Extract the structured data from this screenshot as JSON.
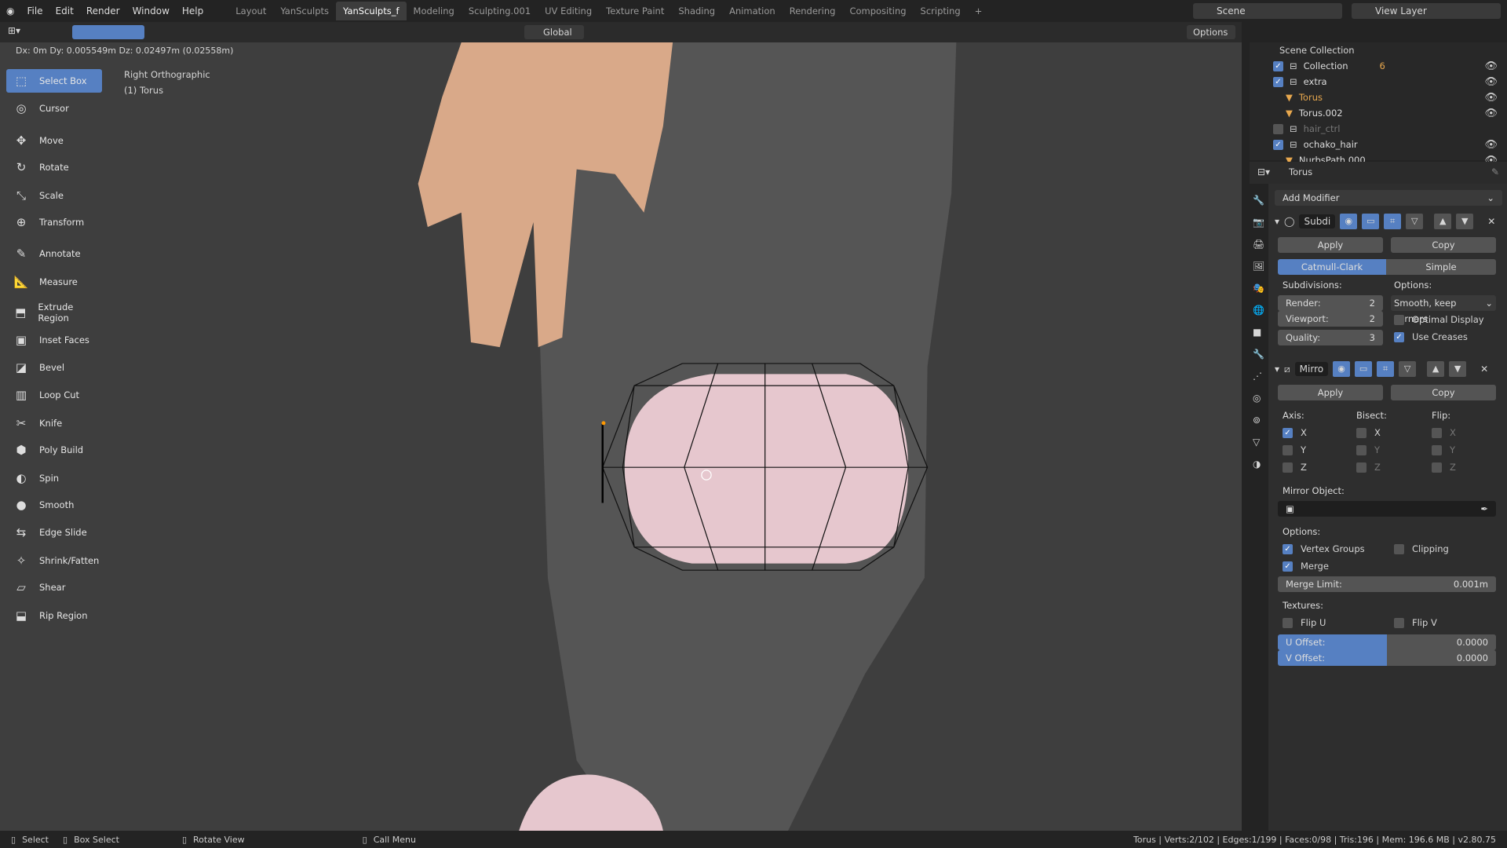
{
  "menu": [
    "File",
    "Edit",
    "Render",
    "Window",
    "Help"
  ],
  "workspaces": [
    "Layout",
    "YanSculpts",
    "YanSculpts_f",
    "Modeling",
    "Sculpting.001",
    "UV Editing",
    "Texture Paint",
    "Shading",
    "Animation",
    "Rendering",
    "Compositing",
    "Scripting",
    "+"
  ],
  "active_workspace": "YanSculpts_f",
  "scene": "Scene",
  "view_layer": "View Layer",
  "header": {
    "orientation": "Global",
    "options": "Options"
  },
  "transform_readout": "Dx: 0m  Dy: 0.005549m  Dz: 0.02497m (0.02558m)",
  "viewport": {
    "view_name": "Right Orthographic",
    "object_name": "(1) Torus"
  },
  "tools": [
    {
      "label": "Select Box",
      "icon": "select-box-icon",
      "active": true
    },
    {
      "label": "Cursor",
      "icon": "cursor-icon"
    },
    {
      "label": "Move",
      "icon": "move-icon"
    },
    {
      "label": "Rotate",
      "icon": "rotate-icon"
    },
    {
      "label": "Scale",
      "icon": "scale-icon"
    },
    {
      "label": "Transform",
      "icon": "transform-icon"
    },
    {
      "label": "Annotate",
      "icon": "annotate-icon"
    },
    {
      "label": "Measure",
      "icon": "measure-icon"
    },
    {
      "label": "Extrude Region",
      "icon": "extrude-icon"
    },
    {
      "label": "Inset Faces",
      "icon": "inset-icon"
    },
    {
      "label": "Bevel",
      "icon": "bevel-icon"
    },
    {
      "label": "Loop Cut",
      "icon": "loop-cut-icon"
    },
    {
      "label": "Knife",
      "icon": "knife-icon"
    },
    {
      "label": "Poly Build",
      "icon": "poly-build-icon"
    },
    {
      "label": "Spin",
      "icon": "spin-icon"
    },
    {
      "label": "Smooth",
      "icon": "smooth-icon"
    },
    {
      "label": "Edge Slide",
      "icon": "edge-slide-icon"
    },
    {
      "label": "Shrink/Fatten",
      "icon": "shrink-fatten-icon"
    },
    {
      "label": "Shear",
      "icon": "shear-icon"
    },
    {
      "label": "Rip Region",
      "icon": "rip-region-icon"
    }
  ],
  "outliner": {
    "root": "Scene Collection",
    "items": [
      {
        "label": "Collection",
        "checked": true,
        "badge": "6"
      },
      {
        "label": "extra",
        "checked": true
      },
      {
        "label": "Torus",
        "selected": true
      },
      {
        "label": "Torus.002"
      },
      {
        "label": "hair_ctrl",
        "checked": false
      },
      {
        "label": "ochako_hair",
        "checked": true
      },
      {
        "label": "NurbsPath.000"
      }
    ]
  },
  "properties": {
    "object": "Torus",
    "add_modifier": "Add Modifier",
    "subsurf": {
      "name": "Subdi",
      "apply": "Apply",
      "copy": "Copy",
      "catmull": "Catmull-Clark",
      "simple": "Simple",
      "subdivisions": "Subdivisions:",
      "options": "Options:",
      "render_label": "Render:",
      "render": "2",
      "viewport_label": "Viewport:",
      "viewport": "2",
      "quality_label": "Quality:",
      "quality": "3",
      "uv_smooth": "Smooth, keep corners",
      "optimal_display": "Optimal Display",
      "use_creases": "Use Creases"
    },
    "mirror": {
      "name": "Mirro",
      "apply": "Apply",
      "copy": "Copy",
      "axis": "Axis:",
      "bisect": "Bisect:",
      "flip": "Flip:",
      "x": "X",
      "y": "Y",
      "z": "Z",
      "mirror_object": "Mirror Object:",
      "options": "Options:",
      "vertex_groups": "Vertex Groups",
      "clipping": "Clipping",
      "merge": "Merge",
      "merge_limit_label": "Merge Limit:",
      "merge_limit": "0.001m",
      "textures": "Textures:",
      "flip_u": "Flip U",
      "flip_v": "Flip V",
      "u_offset_label": "U Offset:",
      "u_offset": "0.0000",
      "v_offset_label": "V Offset:",
      "v_offset": "0.0000"
    }
  },
  "status": {
    "select": "Select",
    "box_select": "Box Select",
    "rotate_view": "Rotate View",
    "call_menu": "Call Menu",
    "stats": "Torus | Verts:2/102 | Edges:1/199 | Faces:0/98 | Tris:196 | Mem: 196.6 MB | v2.80.75"
  },
  "colors": {
    "accent": "#5680c2",
    "selected_object": "#e8a84e",
    "mesh": "#e6c7ce"
  }
}
